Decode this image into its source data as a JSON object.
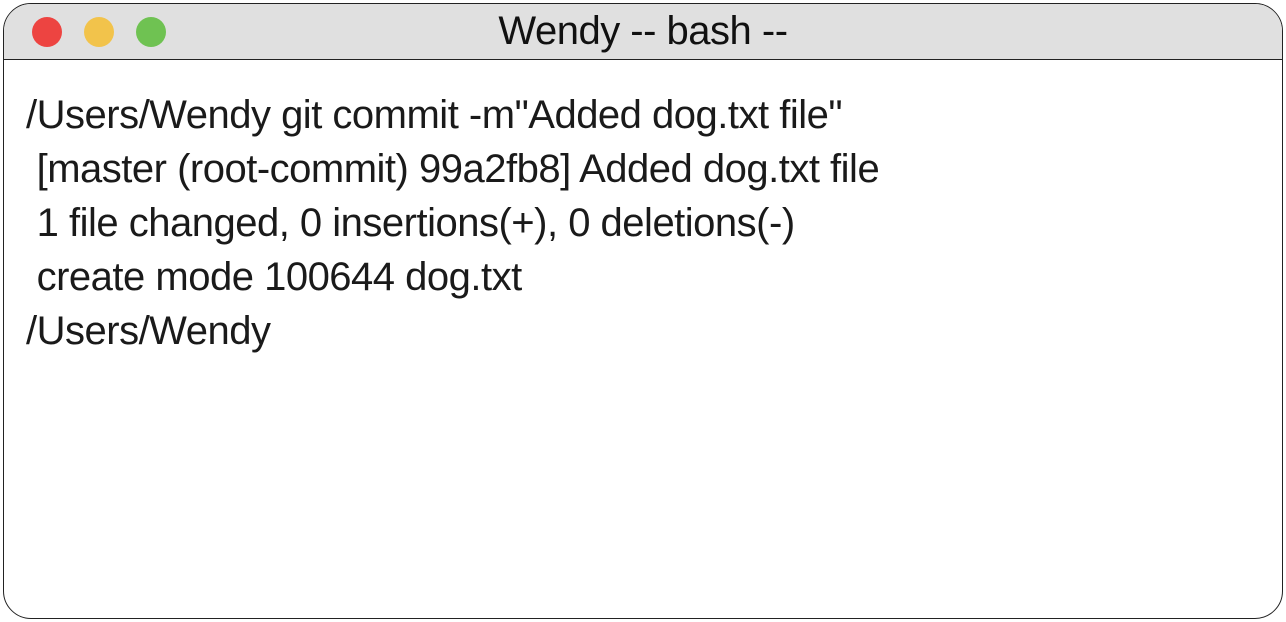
{
  "window": {
    "title": "Wendy -- bash --"
  },
  "colors": {
    "close": "#ed4441",
    "minimize": "#f2c34b",
    "zoom": "#6fc252",
    "titlebar_bg": "#e0e0e0",
    "border": "#222222",
    "text": "#1a1a1a"
  },
  "terminal": {
    "lines": [
      "/Users/Wendy git commit -m\"Added dog.txt file\"",
      " [master (root-commit) 99a2fb8] Added dog.txt file",
      " 1 file changed, 0 insertions(+), 0 deletions(-)",
      " create mode 100644 dog.txt",
      "/Users/Wendy"
    ]
  }
}
